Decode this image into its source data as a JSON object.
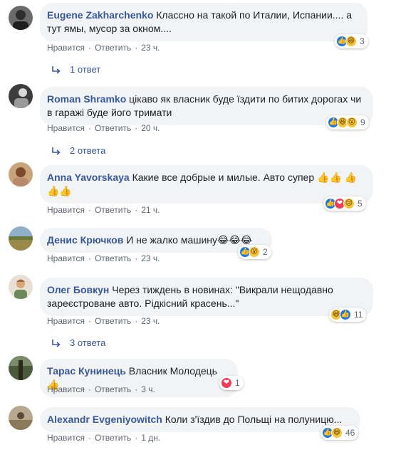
{
  "colors": {
    "link": "#385898",
    "bubble": "#f2f3f5",
    "meta": "#606770",
    "like": "#1877f2",
    "love": "#f33e58",
    "emoji": "#f7c43a"
  },
  "labels": {
    "like": "Нравится",
    "reply": "Ответить",
    "separator": "·"
  },
  "comments": [
    {
      "author": "Eugene Zakharchenko",
      "text": "Классно на такой по Италии, Испании.... а тут ямы, мусор за окном....",
      "time": "23 ч.",
      "reactions": [
        "like-icon",
        "haha-icon"
      ],
      "reaction_count": "3",
      "replies": "1 ответ"
    },
    {
      "author": "Roman Shramko",
      "text": "цікаво як власник буде їздити по битих дорогах чи в гаражі буде його тримати",
      "time": "20 ч.",
      "reactions": [
        "like-icon",
        "haha-icon",
        "wow-icon"
      ],
      "reaction_count": "9",
      "replies": "2 ответа"
    },
    {
      "author": "Anna Yavorskaya",
      "text": "Какие все добрые и милые. Авто супер 👍👍 👍👍👍",
      "time": "21 ч.",
      "reactions": [
        "like-icon",
        "love-icon",
        "sad-icon"
      ],
      "reaction_count": "5",
      "replies": ""
    },
    {
      "author": "Денис Крючков",
      "text": "И не жалко машину😂😂😂",
      "time": "23 ч.",
      "reactions": [
        "like-icon",
        "wow-icon"
      ],
      "reaction_count": "2",
      "replies": ""
    },
    {
      "author": "Олег Бовкун",
      "text": "Через тиждень в новинах: \"Викрали нещодавно зареєстроване авто. Рідкісний красень...\"",
      "time": "23 ч.",
      "reactions": [
        "haha-icon",
        "like-icon"
      ],
      "reaction_count": "11",
      "replies": "3 ответа"
    },
    {
      "author": "Тарас Кунинець",
      "text": "Власник Молодець👍",
      "time": "3 ч.",
      "reactions": [
        "love-icon"
      ],
      "reaction_count": "1",
      "replies": ""
    },
    {
      "author": "Alexandr Evgeniyowitch",
      "text": "Коли з'їздив до Польщі на полуницю...",
      "time": "1 дн.",
      "reactions": [
        "like-icon",
        "haha-icon"
      ],
      "reaction_count": "46",
      "replies": ""
    }
  ]
}
